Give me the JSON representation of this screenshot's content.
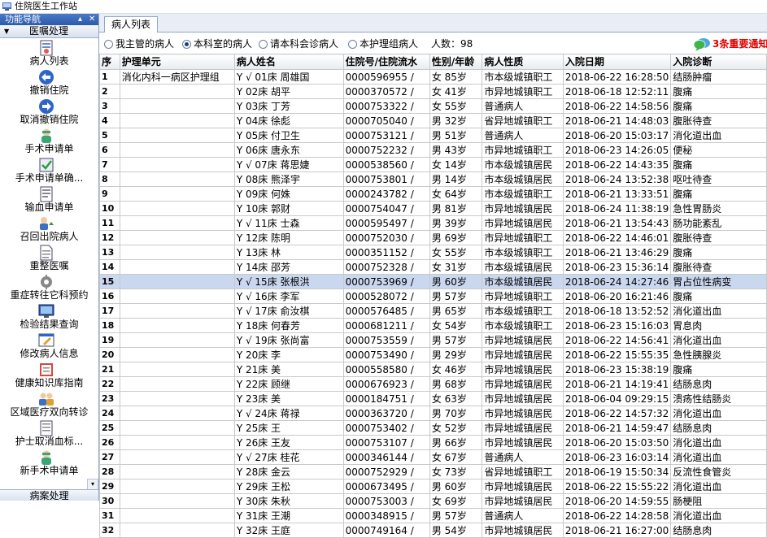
{
  "window": {
    "title": "住院医生工作站"
  },
  "nav": {
    "header": "功能导航",
    "pin": "▴",
    "close": "✕",
    "section": "医嘱处理",
    "footer": "病案处理",
    "scroll_down": "▾",
    "items": [
      {
        "label": "病人列表",
        "icon": "patient-list-icon"
      },
      {
        "label": "撤销住院",
        "icon": "undo-arrow-icon"
      },
      {
        "label": "取消撤销住院",
        "icon": "redo-arrow-icon"
      },
      {
        "label": "手术申请单",
        "icon": "surgery-doctor-icon"
      },
      {
        "label": "手术申请单确...",
        "icon": "checked-form-icon"
      },
      {
        "label": "输血申请单",
        "icon": "transfusion-form-icon"
      },
      {
        "label": "召回出院病人",
        "icon": "recall-patient-icon"
      },
      {
        "label": "重整医嘱",
        "icon": "document-icon"
      },
      {
        "label": "重症转往它科预约",
        "icon": "gear-icon"
      },
      {
        "label": "检验结果查询",
        "icon": "monitor-icon"
      },
      {
        "label": "修改病人信息",
        "icon": "edit-window-icon"
      },
      {
        "label": "健康知识库指南",
        "icon": "book-icon"
      },
      {
        "label": "区域医疗双向转诊",
        "icon": "people-icon"
      },
      {
        "label": "护士取消血标...",
        "icon": "form-icon"
      },
      {
        "label": "新手术申请单",
        "icon": "surgery-doctor-icon"
      }
    ]
  },
  "tabs": [
    {
      "label": "病人列表"
    }
  ],
  "filter": {
    "options": [
      {
        "label": "我主管的病人",
        "selected": false
      },
      {
        "label": "本科室的病人",
        "selected": true
      },
      {
        "label": "请本科会诊病人",
        "selected": false
      },
      {
        "label": "本护理组病人",
        "selected": false
      }
    ],
    "count_text": "人数：98",
    "alert_text": "3条重要通知"
  },
  "table": {
    "headers": [
      "序",
      "护理单元",
      "病人姓名",
      "住院号/住院流水",
      "性别/年龄",
      "病人性质",
      "入院日期",
      "入院诊断"
    ],
    "selected_index": 14,
    "rows": [
      [
        "1",
        "消化内科一病区护理组",
        "Y √ 01床 周雄国",
        "0000596955 /",
        "女 85岁",
        "市本级城镇职工",
        "2018-06-22 16:28:50",
        "结肠肿瘤"
      ],
      [
        "2",
        "",
        "Y 02床 胡平",
        "0000370572 /",
        "女 41岁",
        "市异地城镇职工",
        "2018-06-18 12:52:11",
        "腹痛"
      ],
      [
        "3",
        "",
        "Y 03床 丁芳",
        "0000753322 /",
        "女 55岁",
        "普通病人",
        "2018-06-22 14:58:56",
        "腹痛"
      ],
      [
        "4",
        "",
        "Y 04床 徐彪",
        "0000705040 /",
        "男 32岁",
        "省异地城镇职工",
        "2018-06-21 14:48:03",
        "腹胀待查"
      ],
      [
        "5",
        "",
        "Y 05床 付卫生",
        "0000753121 /",
        "男 51岁",
        "普通病人",
        "2018-06-20 15:03:17",
        "消化道出血"
      ],
      [
        "6",
        "",
        "Y 06床 唐永东",
        "0000752232 /",
        "男 43岁",
        "市异地城镇职工",
        "2018-06-23 14:26:05",
        "便秘"
      ],
      [
        "7",
        "",
        "Y √ 07床 蒋思婕",
        "0000538560 /",
        "女 14岁",
        "市本级城镇居民",
        "2018-06-22 14:43:35",
        "腹痛"
      ],
      [
        "8",
        "",
        "Y 08床 熊泽宇",
        "0000753801 /",
        "男 14岁",
        "市本级城镇居民",
        "2018-06-24 13:52:38",
        "呕吐待查"
      ],
      [
        "9",
        "",
        "Y 09床 何姝",
        "0000243782 /",
        "女 64岁",
        "市本级城镇职工",
        "2018-06-21 13:33:51",
        "腹痛"
      ],
      [
        "10",
        "",
        "Y 10床 郭财",
        "0000754047 /",
        "男 81岁",
        "市异地城镇居民",
        "2018-06-24 11:38:19",
        "急性胃肠炎"
      ],
      [
        "11",
        "",
        "Y √ 11床 士森",
        "0000595497 /",
        "男 39岁",
        "市异地城镇居民",
        "2018-06-21 13:54:43",
        "肠功能紊乱"
      ],
      [
        "12",
        "",
        "Y 12床 陈明",
        "0000752030 /",
        "男 69岁",
        "市异地城镇职工",
        "2018-06-22 14:46:01",
        "腹胀待查"
      ],
      [
        "13",
        "",
        "Y 13床 林",
        "0000351152 /",
        "女 55岁",
        "市本级城镇职工",
        "2018-06-21 13:46:29",
        "腹痛"
      ],
      [
        "14",
        "",
        "Y 14床 邵芳",
        "0000752328 /",
        "女 31岁",
        "市本级城镇居民",
        "2018-06-23 15:36:14",
        "腹胀待查"
      ],
      [
        "15",
        "",
        "Y √ 15床 张根洪",
        "0000753969 /",
        "男 60岁",
        "市本级城镇居民",
        "2018-06-24 14:27:46",
        "胃占位性病变"
      ],
      [
        "16",
        "",
        "Y √ 16床 李军",
        "0000528072 /",
        "男 57岁",
        "市异地城镇职工",
        "2018-06-20 16:21:46",
        "腹痛"
      ],
      [
        "17",
        "",
        "Y √ 17床 俞汝棋",
        "0000576485 /",
        "男 65岁",
        "市本级城镇职工",
        "2018-06-18 13:52:52",
        "消化道出血"
      ],
      [
        "18",
        "",
        "Y 18床 何春芳",
        "0000681211 /",
        "女 54岁",
        "市本级城镇职工",
        "2018-06-23 15:16:03",
        "胃息肉"
      ],
      [
        "19",
        "",
        "Y √ 19床 张尚富",
        "0000753559 /",
        "男 57岁",
        "市异地城镇居民",
        "2018-06-22 14:56:41",
        "消化道出血"
      ],
      [
        "20",
        "",
        "Y 20床 李",
        "0000753490 /",
        "男 29岁",
        "市异地城镇居民",
        "2018-06-22 15:55:35",
        "急性胰腺炎"
      ],
      [
        "21",
        "",
        "Y 21床 美",
        "0000558580 /",
        "女 46岁",
        "市异地城镇居民",
        "2018-06-23 15:38:19",
        "腹痛"
      ],
      [
        "22",
        "",
        "Y 22床 顾继",
        "0000676923 /",
        "男 68岁",
        "市异地城镇居民",
        "2018-06-21 14:19:41",
        "结肠息肉"
      ],
      [
        "23",
        "",
        "Y 23床 美",
        "0000184751 /",
        "女 63岁",
        "市异地城镇居民",
        "2018-06-04 09:29:15",
        "溃疡性结肠炎"
      ],
      [
        "24",
        "",
        "Y √ 24床 蒋禄",
        "0000363720 /",
        "男 70岁",
        "市异地城镇居民",
        "2018-06-22 14:57:32",
        "消化道出血"
      ],
      [
        "25",
        "",
        "Y 25床 王",
        "0000753402 /",
        "女 52岁",
        "市异地城镇居民",
        "2018-06-21 14:59:47",
        "结肠息肉"
      ],
      [
        "26",
        "",
        "Y 26床 王友",
        "0000753107 /",
        "男 66岁",
        "市异地城镇居民",
        "2018-06-20 15:03:50",
        "消化道出血"
      ],
      [
        "27",
        "",
        "Y √ 27床 桂花",
        "0000346144 /",
        "女 67岁",
        "普通病人",
        "2018-06-23 16:03:14",
        "消化道出血"
      ],
      [
        "28",
        "",
        "Y 28床 金云",
        "0000752929 /",
        "女 73岁",
        "省异地城镇职工",
        "2018-06-19 15:50:34",
        "反流性食管炎"
      ],
      [
        "29",
        "",
        "Y 29床 王松",
        "0000673495 /",
        "男 60岁",
        "市异地城镇居民",
        "2018-06-22 15:55:22",
        "消化道出血"
      ],
      [
        "30",
        "",
        "Y 30床 朱秋",
        "0000753003 /",
        "女 69岁",
        "市异地城镇居民",
        "2018-06-20 14:59:55",
        "肠梗阻"
      ],
      [
        "31",
        "",
        "Y 31床 王潮",
        "0000348915 /",
        "男 57岁",
        "普通病人",
        "2018-06-22 14:28:58",
        "消化道出血"
      ],
      [
        "32",
        "",
        "Y 32床 王庭",
        "0000749164 /",
        "男 54岁",
        "市异地城镇居民",
        "2018-06-21 16:27:00",
        "结肠息肉"
      ]
    ]
  }
}
